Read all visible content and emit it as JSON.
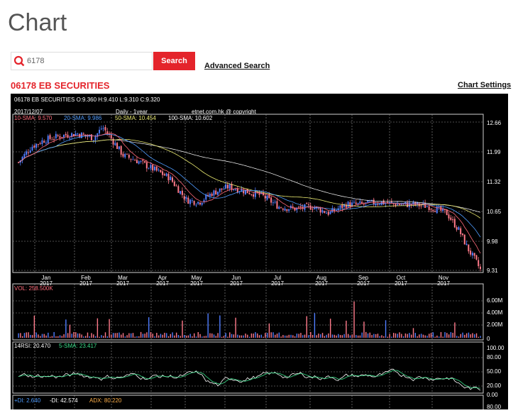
{
  "page": {
    "title": "Chart"
  },
  "search": {
    "value": "6178",
    "button_label": "Search",
    "advanced_label": "Advanced Search"
  },
  "stock": {
    "title": "06178 EB SECURITIES",
    "settings_label": "Chart Settings"
  },
  "chart_data": {
    "type": "candlestick",
    "header": {
      "quote_line": "06178 EB SECURITIES  O:9.360  H:9.410  L:9.310  C:9.320",
      "date": "2017/12/07",
      "period": "Daily - 1year",
      "credit": "etnet.com.hk @ copyright",
      "sma10": "10-SMA: 9.570",
      "sma20": "20-SMA: 9.986",
      "sma50": "50-SMA: 10.454",
      "sma100": "100-SMA: 10.602"
    },
    "price_axis": {
      "ticks": [
        "12.66",
        "11.99",
        "11.32",
        "10.65",
        "9.98",
        "9.31"
      ],
      "range": [
        9.31,
        12.66
      ]
    },
    "months": [
      "Jan 2017",
      "Feb 2017",
      "Mar 2017",
      "Apr 2017",
      "May 2017",
      "Jun 2017",
      "Jul 2017",
      "Aug 2017",
      "Sep 2017",
      "Oct 2017",
      "Nov 2017"
    ],
    "month_labels": [
      {
        "m": "Jan",
        "y": "2017"
      },
      {
        "m": "Feb",
        "y": "2017"
      },
      {
        "m": "Mar",
        "y": "2017"
      },
      {
        "m": "Apr",
        "y": "2017"
      },
      {
        "m": "May",
        "y": "2017"
      },
      {
        "m": "Jun",
        "y": "2017"
      },
      {
        "m": "Jul",
        "y": "2017"
      },
      {
        "m": "Aug",
        "y": "2017"
      },
      {
        "m": "Sep",
        "y": "2017"
      },
      {
        "m": "Oct",
        "y": "2017"
      },
      {
        "m": "Nov",
        "y": "2017"
      }
    ],
    "price_path": [
      [
        0,
        11.75
      ],
      [
        0.3,
        12.1
      ],
      [
        0.6,
        12.25
      ],
      [
        1.0,
        12.35
      ],
      [
        1.4,
        12.4
      ],
      [
        1.8,
        12.3
      ],
      [
        2.0,
        12.55
      ],
      [
        2.2,
        12.3
      ],
      [
        2.5,
        11.9
      ],
      [
        2.8,
        11.8
      ],
      [
        3.2,
        11.6
      ],
      [
        3.6,
        11.4
      ],
      [
        4.0,
        10.9
      ],
      [
        4.3,
        10.85
      ],
      [
        4.6,
        11.05
      ],
      [
        5.0,
        11.2
      ],
      [
        5.4,
        11.1
      ],
      [
        5.8,
        11.0
      ],
      [
        6.2,
        10.75
      ],
      [
        6.6,
        10.7
      ],
      [
        7.0,
        10.75
      ],
      [
        7.4,
        10.6
      ],
      [
        7.8,
        10.8
      ],
      [
        8.2,
        10.8
      ],
      [
        8.6,
        10.85
      ],
      [
        9.0,
        10.8
      ],
      [
        9.4,
        10.8
      ],
      [
        9.8,
        10.75
      ],
      [
        10.2,
        10.6
      ],
      [
        10.5,
        10.2
      ],
      [
        10.7,
        9.8
      ],
      [
        10.9,
        9.5
      ],
      [
        11.0,
        9.32
      ]
    ],
    "volume": {
      "label": "VOL: 258.500K",
      "ticks": [
        "6.00M",
        "4.00M",
        "2.00M",
        "0"
      ],
      "range": [
        0,
        6.0
      ]
    },
    "rsi": {
      "label": "14RSI: 20.470",
      "sma_label": "5-SMA: 23.417",
      "ticks": [
        "100.00",
        "80.00",
        "50.00",
        "20.00",
        "0.00"
      ],
      "range": [
        0,
        100
      ]
    },
    "dmi": {
      "plus_di": "+DI: 2.640",
      "minus_di": "-DI: 42.574",
      "adx": "ADX: 80.220",
      "ticks": [
        "80.00"
      ]
    }
  }
}
